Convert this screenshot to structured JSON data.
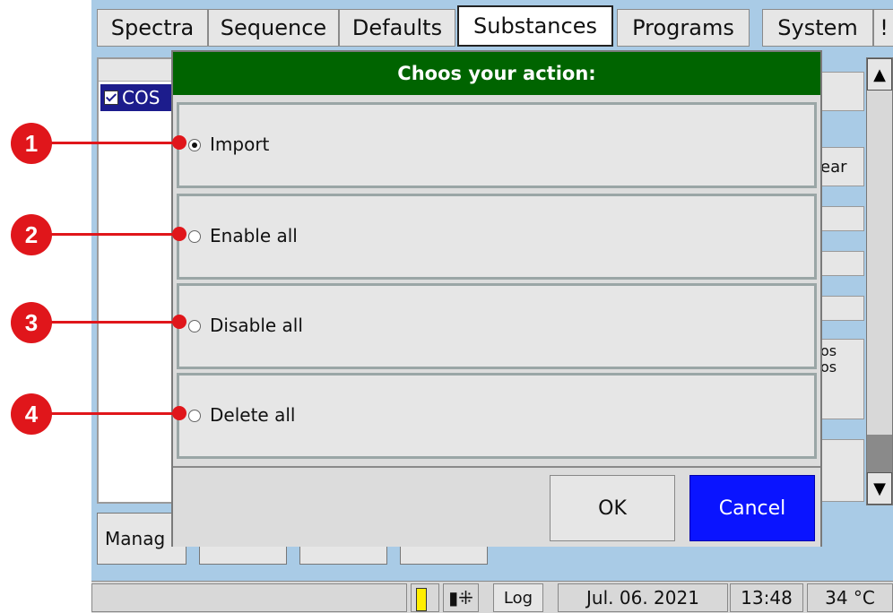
{
  "tabs": [
    {
      "label": "Spectra"
    },
    {
      "label": "Sequence"
    },
    {
      "label": "Defaults"
    },
    {
      "label": "Substances",
      "active": true
    },
    {
      "label": "Programs"
    },
    {
      "label": "System"
    },
    {
      "label": "!"
    }
  ],
  "list": {
    "selected_item": "COS",
    "selected_checked": true
  },
  "side_fragments": {
    "clear_button_partial": "ear",
    "info_line_1": "os",
    "info_line_2": "os"
  },
  "bottom_buttons": {
    "manage_partial": "Manag"
  },
  "dialog": {
    "title": "Choos your action:",
    "options": [
      {
        "label": "Import",
        "selected": true
      },
      {
        "label": "Enable all",
        "selected": false
      },
      {
        "label": "Disable all",
        "selected": false
      },
      {
        "label": "Delete all",
        "selected": false
      }
    ],
    "ok_label": "OK",
    "cancel_label": "Cancel"
  },
  "status": {
    "log_label": "Log",
    "date": "Jul. 06. 2021",
    "time": "13:48",
    "temperature": "34 °C"
  },
  "callouts": [
    "1",
    "2",
    "3",
    "4"
  ],
  "colors": {
    "dialog_title_bg": "#006400",
    "cancel_bg": "#0a14ff",
    "callout": "#e0161b",
    "app_bg": "#a9cbe6",
    "selection": "#1c1c8c"
  }
}
